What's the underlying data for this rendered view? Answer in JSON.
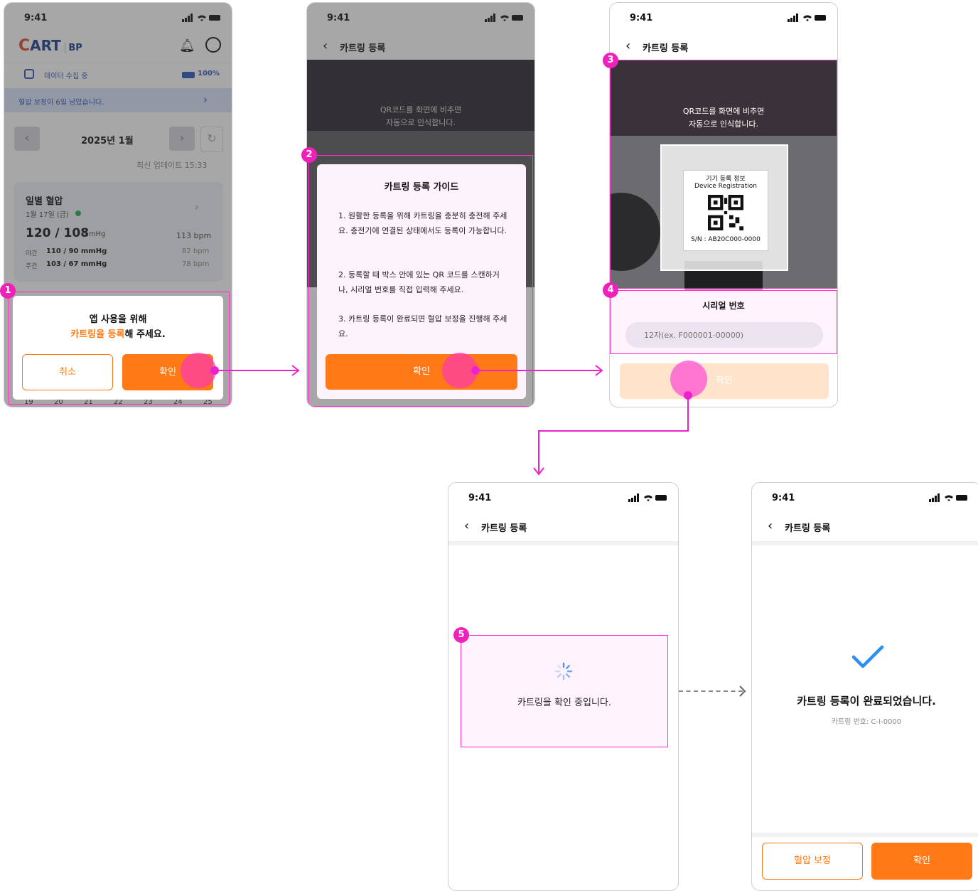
{
  "status_time": "9:41",
  "screen1": {
    "logo_c": "C",
    "logo_art": "ART",
    "logo_bp": "BP",
    "collect_label": "데이터 수집 중",
    "battery": "100%",
    "notice": "혈압 보정이 6일 남았습니다.",
    "month": "2025년 1월",
    "last_update": "최신 업데이트 15:33",
    "card_title": "일별 혈압",
    "card_date": "1월 17일 (금)",
    "bp_main": "120 / 108",
    "bp_unit": "mmHg",
    "bpm_main": "113 bpm",
    "night_label": "야간",
    "night_value": "110 / 90 mmHg",
    "night_bpm": "82 bpm",
    "day_label": "주간",
    "day_value": "103 / 67 mmHg",
    "day_bpm": "78 bpm",
    "dialog_line1": "앱 사용을 위해",
    "dialog_highlight": "카트링을 등록",
    "dialog_rest": "해 주세요.",
    "cancel": "취소",
    "confirm": "확인",
    "calendar_days": [
      "19",
      "20",
      "21",
      "22",
      "23",
      "24",
      "25"
    ]
  },
  "screen2": {
    "nav_title": "카트링 등록",
    "qr_hint1": "QR코드를 화면에 비추면",
    "qr_hint2": "자동으로 인식합니다.",
    "guide_title": "카트링 등록 가이드",
    "guide_1": "1. 원활한 등록을 위해 카트링을 충분히 충전해 주세요. 충전기에 연결된 상태에서도 등록이 가능합니다.",
    "guide_2": "2. 등록할 때 박스 안에 있는 QR 코드를 스캔하거나, 시리얼 번호를 직접 입력해 주세요.",
    "guide_3": "3. 카트링 등록이 완료되면 혈압 보정을 진행해 주세요.",
    "confirm": "확인"
  },
  "screen3": {
    "nav_title": "카트링 등록",
    "qr_hint1": "QR코드를 화면에 비추면",
    "qr_hint2": "자동으로 인식합니다.",
    "label_title": "기기 등록 정보",
    "label_sub": "Device Registration",
    "serial_no": "S/N : AB20C000-0000",
    "serial_title": "시리얼 번호",
    "serial_placeholder": "12자(ex. F000001-00000)",
    "confirm": "확인"
  },
  "screen4": {
    "nav_title": "카트링 등록",
    "loading_text": "카트링을 확인 중입니다."
  },
  "screen5": {
    "nav_title": "카트링 등록",
    "done_title": "카트링 등록이 완료되었습니다.",
    "done_sub": "카트링 번호: C-I-0000",
    "calibrate": "혈압 보정",
    "confirm": "확인"
  },
  "badges": [
    "1",
    "2",
    "3",
    "4",
    "5"
  ],
  "colors": {
    "accent": "#ff7a16",
    "annotation": "#ee22cc",
    "check": "#2b8ff0"
  }
}
